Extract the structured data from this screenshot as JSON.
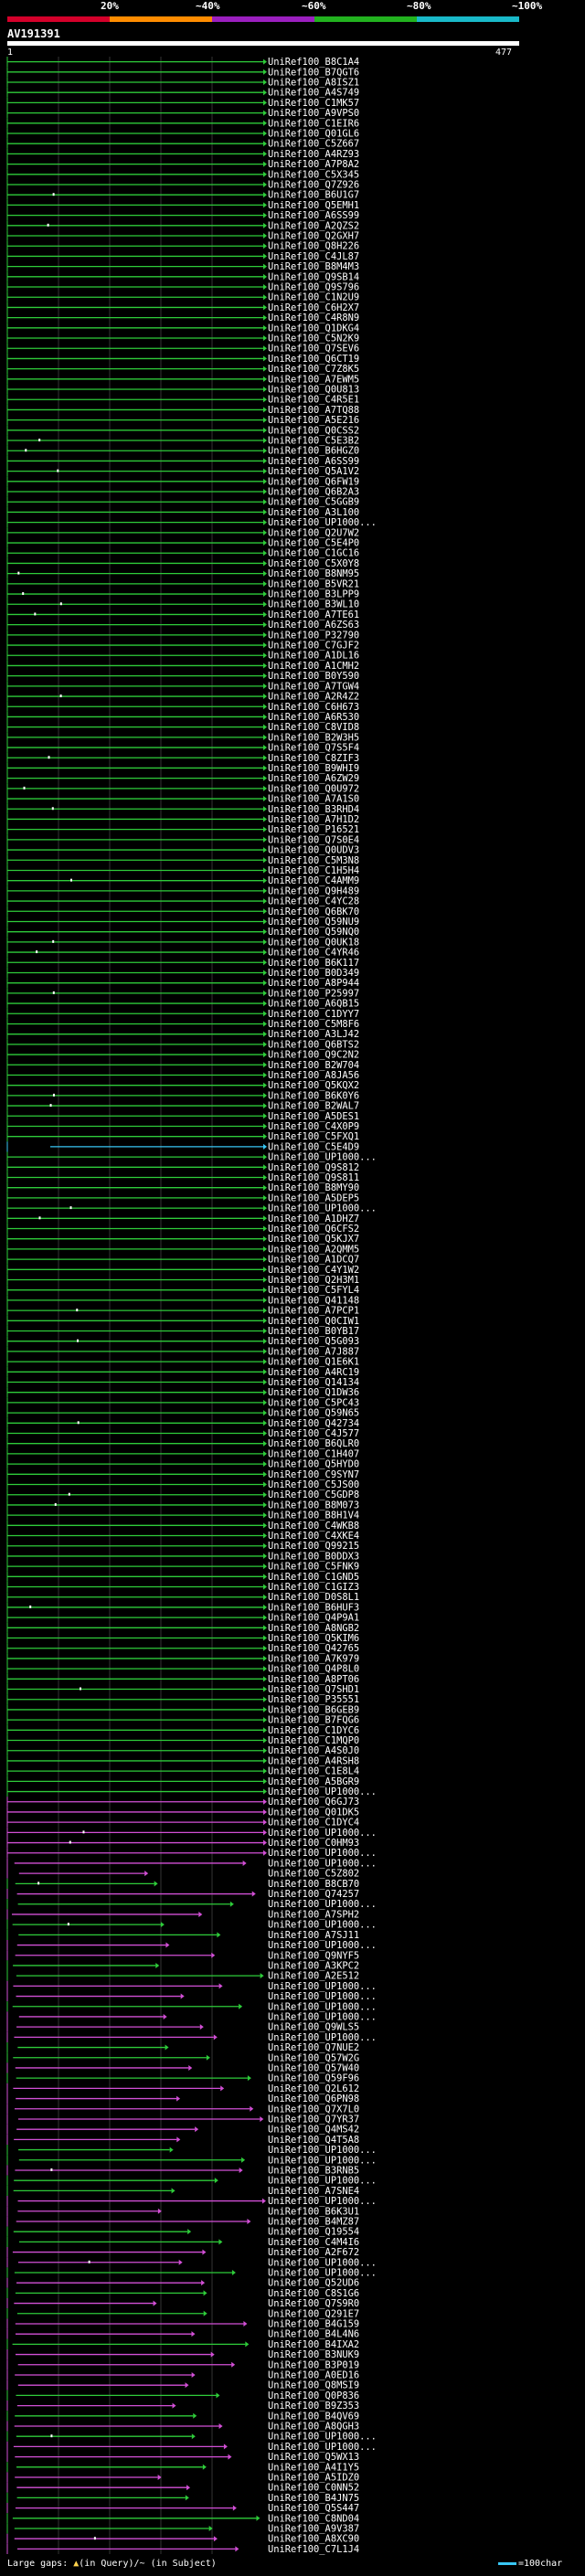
{
  "scale": {
    "labels": [
      "20%",
      "~40%",
      "~60%",
      "~80%",
      "~100%"
    ],
    "colors": [
      "#d4002a",
      "#ff8c00",
      "#9b1fbf",
      "#22b21f",
      "#19b9c9"
    ]
  },
  "query": {
    "title": "AV191391",
    "start": "1",
    "end": "477"
  },
  "legend": {
    "text": "Large gaps: ",
    "in_query": "(in Query)",
    "slash": "/",
    "in_subject": "~ (in Subject)",
    "scale_text": "=100char"
  },
  "colors": {
    "green": "#2ecc3a",
    "magenta": "#d24fd6",
    "cyan": "#38c6f4",
    "white": "#ffffff",
    "gray": "#666666"
  },
  "hits": [
    "UniRef100_B8C1A4",
    "UniRef100_B7QGT6",
    "UniRef100_A8ISZ1",
    "UniRef100_A4S749",
    "UniRef100_C1MK57",
    "UniRef100_A9VPS0",
    "UniRef100_C1EIR6",
    "UniRef100_Q01GL6",
    "UniRef100_C5Z667",
    "UniRef100_A4RZ93",
    "UniRef100_A7P8A2",
    "UniRef100_C5X345",
    "UniRef100_Q7Z926",
    "UniRef100_B6U1G7",
    "UniRef100_Q5EMH1",
    "UniRef100_A6SS99",
    "UniRef100_A2QZS2",
    "UniRef100_Q2GXH7",
    "UniRef100_Q8H226",
    "UniRef100_C4JL87",
    "UniRef100_B8M4M3",
    "UniRef100_Q9SB14",
    "UniRef100_Q9S796",
    "UniRef100_C1N2U9",
    "UniRef100_C6H2X7",
    "UniRef100_C4R8N9",
    "UniRef100_Q1DKG4",
    "UniRef100_C5N2K9",
    "UniRef100_Q7SEV6",
    "UniRef100_Q6CT19",
    "UniRef100_C7Z8K5",
    "UniRef100_A7EWM5",
    "UniRef100_Q0U813",
    "UniRef100_C4R5E1",
    "UniRef100_A7TQ88",
    "UniRef100_A5E216",
    "UniRef100_Q0CSS2",
    "UniRef100_C5E3B2",
    "UniRef100_B6HGZ0",
    "UniRef100_A6SS99",
    "UniRef100_Q5A1V2",
    "UniRef100_Q6FW19",
    "UniRef100_Q6B2A3",
    "UniRef100_C5GGB9",
    "UniRef100_A3L100",
    "UniRef100_UP1000...",
    "UniRef100_Q2U7W2",
    "UniRef100_C5E4P0",
    "UniRef100_C1GC16",
    "UniRef100_C5X0Y8",
    "UniRef100_B8NM95",
    "UniRef100_B5VR21",
    "UniRef100_B3LPP9",
    "UniRef100_B3WL10",
    "UniRef100_A7TE61",
    "UniRef100_A6ZS63",
    "UniRef100_P32790",
    "UniRef100_C7GJF2",
    "UniRef100_A1DL16",
    "UniRef100_A1CMH2",
    "UniRef100_B0Y590",
    "UniRef100_A7TGW4",
    "UniRef100_A2R4Z2",
    "UniRef100_C6H673",
    "UniRef100_A6R530",
    "UniRef100_C8VID8",
    "UniRef100_B2W3H5",
    "UniRef100_Q7S5F4",
    "UniRef100_C8ZIF3",
    "UniRef100_B9WHI9",
    "UniRef100_A6ZW29",
    "UniRef100_Q0U972",
    "UniRef100_A7A1S0",
    "UniRef100_B3RHD4",
    "UniRef100_A7H1D2",
    "UniRef100_P16521",
    "UniRef100_Q7S0E4",
    "UniRef100_Q0UDV3",
    "UniRef100_C5M3N8",
    "UniRef100_C1H5H4",
    "UniRef100_C4AMM9",
    "UniRef100_Q9H489",
    "UniRef100_C4YC28",
    "UniRef100_Q6BK70",
    "UniRef100_Q59NU9",
    "UniRef100_Q59NQ0",
    "UniRef100_Q0UK18",
    "UniRef100_C4YR46",
    "UniRef100_B6K117",
    "UniRef100_B0D349",
    "UniRef100_A8P944",
    "UniRef100_P25997",
    "UniRef100_A6QB15",
    "UniRef100_C1DYY7",
    "UniRef100_C5M8F6",
    "UniRef100_A3LJ42",
    "UniRef100_Q6BTS2",
    "UniRef100_Q9C2N2",
    "UniRef100_B2W704",
    "UniRef100_A8JA56",
    "UniRef100_Q5KQX2",
    "UniRef100_B6K0Y6",
    "UniRef100_B2WAL7",
    "UniRef100_A5DES1",
    "UniRef100_C4X0P9",
    "UniRef100_C5FXQ1",
    "UniRef100_C5E4D9",
    "UniRef100_UP1000...",
    "UniRef100_Q9S812",
    "UniRef100_Q9S811",
    "UniRef100_B8MY90",
    "UniRef100_A5DEP5",
    "UniRef100_UP1000...",
    "UniRef100_A1DHZ7",
    "UniRef100_Q6CFS2",
    "UniRef100_Q5KJX7",
    "UniRef100_A2QMM5",
    "UniRef100_A1DCQ7",
    "UniRef100_C4Y1W2",
    "UniRef100_Q2H3M1",
    "UniRef100_C5FYL4",
    "UniRef100_Q41148",
    "UniRef100_A7PCP1",
    "UniRef100_Q0CIW1",
    "UniRef100_B0YB17",
    "UniRef100_Q5G093",
    "UniRef100_A7J887",
    "UniRef100_Q1E6K1",
    "UniRef100_A4RC19",
    "UniRef100_Q14134",
    "UniRef100_Q1DW36",
    "UniRef100_C5PC43",
    "UniRef100_Q59N65",
    "UniRef100_Q42734",
    "UniRef100_C4J577",
    "UniRef100_B6QLR0",
    "UniRef100_C1H407",
    "UniRef100_Q5HYD0",
    "UniRef100_C9SYN7",
    "UniRef100_C5JS00",
    "UniRef100_C5GDP8",
    "UniRef100_B8M073",
    "UniRef100_B8H1V4",
    "UniRef100_C4WKB8",
    "UniRef100_C4XKE4",
    "UniRef100_Q99215",
    "UniRef100_B0DDX3",
    "UniRef100_C5FNK9",
    "UniRef100_C1GND5",
    "UniRef100_C1GIZ3",
    "UniRef100_D0S8L1",
    "UniRef100_B6HUF3",
    "UniRef100_Q4P9A1",
    "UniRef100_A8NGB2",
    "UniRef100_Q5KIM6",
    "UniRef100_Q42765",
    "UniRef100_A7K979",
    "UniRef100_Q4P8L0",
    "UniRef100_A8PT06",
    "UniRef100_Q7SHD1",
    "UniRef100_P35551",
    "UniRef100_B6GEB9",
    "UniRef100_B7FQG6",
    "UniRef100_C1DYC6",
    "UniRef100_C1MQP0",
    "UniRef100_A4S0J0",
    "UniRef100_A4RSH8",
    "UniRef100_C1E8L4",
    "UniRef100_A5BGR9",
    "UniRef100_UP1000...",
    "UniRef100_Q6GJ73",
    "UniRef100_Q01DK5",
    "UniRef100_C1DYC4",
    "UniRef100_UP1000...",
    "UniRef100_C0HM93",
    "UniRef100_UP1000...",
    "UniRef100_UP1000...",
    "UniRef100_C5Z802",
    "UniRef100_B8CB70",
    "UniRef100_Q74257",
    "UniRef100_UP1000...",
    "UniRef100_A7SPH2",
    "UniRef100_UP1000...",
    "UniRef100_A7SJ11",
    "UniRef100_UP1000...",
    "UniRef100_Q9NYF5",
    "UniRef100_A3KPC2",
    "UniRef100_A2E512",
    "UniRef100_UP1000...",
    "UniRef100_UP1000...",
    "UniRef100_UP1000...",
    "UniRef100_UP1000...",
    "UniRef100_Q9WLS5",
    "UniRef100_UP1000...",
    "UniRef100_Q7NUE2",
    "UniRef100_Q57W2G",
    "UniRef100_Q57W40",
    "UniRef100_Q59F96",
    "UniRef100_Q2L612",
    "UniRef100_Q6PN98",
    "UniRef100_Q7X7L0",
    "UniRef100_Q7YR37",
    "UniRef100_Q4MS42",
    "UniRef100_Q4T5A8",
    "UniRef100_UP1000...",
    "UniRef100_UP1000...",
    "UniRef100_B3RNB5",
    "UniRef100_UP1000...",
    "UniRef100_A7SNE4",
    "UniRef100_UP1000...",
    "UniRef100_B6K3U1",
    "UniRef100_B4MZ87",
    "UniRef100_Q19554",
    "UniRef100_C4M4I6",
    "UniRef100_A2F672",
    "UniRef100_UP1000...",
    "UniRef100_UP1000...",
    "UniRef100_Q52UD6",
    "UniRef100_C8S1G6",
    "UniRef100_Q7S9R0",
    "UniRef100_Q291E7",
    "UniRef100_B4G159",
    "UniRef100_B4L4N6",
    "UniRef100_B4IXA2",
    "UniRef100_B3NUK9",
    "UniRef100_B3P019",
    "UniRef100_A0ED16",
    "UniRef100_Q8MSI9",
    "UniRef100_Q0P836",
    "UniRef100_B9Z353",
    "UniRef100_B4QV69",
    "UniRef100_A8QGH3",
    "UniRef100_UP1000...",
    "UniRef100_UP1000...",
    "UniRef100_Q5WX13",
    "UniRef100_A4I1Y5",
    "UniRef100_A5IDZ0",
    "UniRef100_C0NN52",
    "UniRef100_B4JN75",
    "UniRef100_Q5S447",
    "UniRef100_C8ND04",
    "UniRef100_A9V387",
    "UniRef100_A8XC90",
    "UniRef100_C7L1J4"
  ]
}
